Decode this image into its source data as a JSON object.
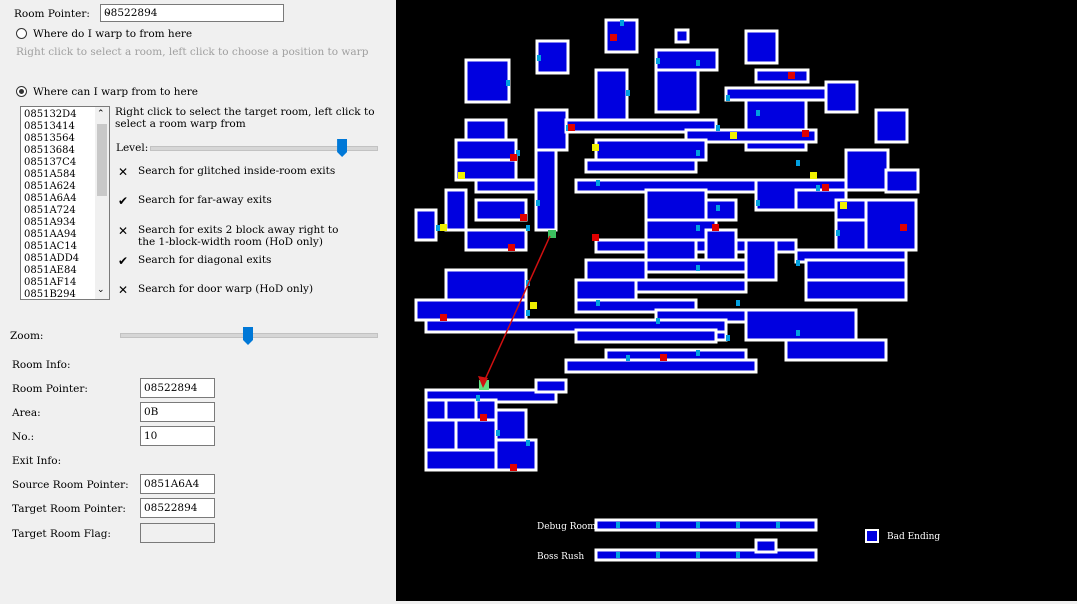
{
  "room_pointer_label": "Room Pointer:",
  "room_pointer_value": "08522894",
  "opt_warp_from_here": "Where do I warp to from here",
  "opt_warp_from_hint": "Right click to select a room, left click to choose a position to warp",
  "opt_warp_to_here": "Where can I warp from to here",
  "opt_warp_to_hint": "Right click to select the target room, left click to select a room warp from",
  "list_items": [
    "085132D4",
    "08513414",
    "08513564",
    "08513684",
    "085137C4",
    "0851A584",
    "0851A624",
    "0851A6A4",
    "0851A724",
    "0851A934",
    "0851AA94",
    "0851AC14",
    "0851ADD4",
    "0851AE84",
    "0851AF14",
    "0851B294"
  ],
  "level_label": "Level:",
  "level_value": 0.85,
  "checks": [
    {
      "mark": "✕",
      "label": "Search for glitched inside-room exits"
    },
    {
      "mark": "✔",
      "label": "Search for far-away exits"
    },
    {
      "mark": "✕",
      "label": "Search for exits 2 block away right to",
      "label2": "the 1-block-width room (HoD only)"
    },
    {
      "mark": "✔",
      "label": "Search for diagonal exits"
    },
    {
      "mark": "✕",
      "label": "Search for door warp (HoD only)"
    }
  ],
  "zoom_label": "Zoom:",
  "zoom_value": 0.5,
  "room_info_label": "Room Info:",
  "room_pointer_field_label": "Room Pointer:",
  "room_pointer_field": "08522894",
  "area_label": "Area:",
  "area_value": "0B",
  "no_label": "No.:",
  "no_value": "10",
  "exit_info_label": "Exit Info:",
  "source_room_label": "Source Room Pointer:",
  "source_room_value": "0851A6A4",
  "target_room_label": "Target Room Pointer:",
  "target_room_value": "08522894",
  "target_flag_label": "Target Room Flag:",
  "target_flag_value": "",
  "map": {
    "debug_room": "Debug Room",
    "boss_rush": "Boss Rush",
    "bad_ending": "Bad Ending",
    "room_color": "#0000e0",
    "wall_color": "#ffffff",
    "door_color": "#00a0e0",
    "save_color": "#e00000",
    "warp_color": "#f0f000",
    "arrow_color": "#d01010"
  }
}
